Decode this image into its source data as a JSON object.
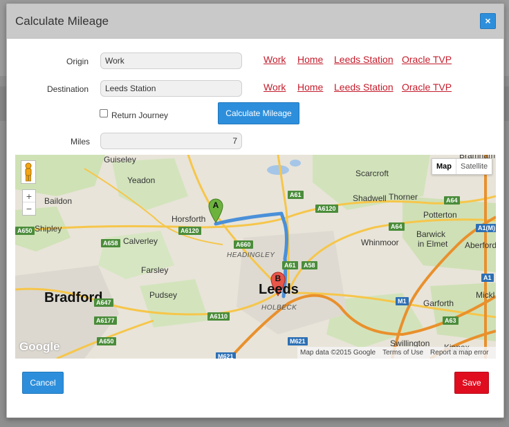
{
  "modal": {
    "title": "Calculate Mileage",
    "close_label": "×"
  },
  "form": {
    "origin_label": "Origin",
    "origin_value": "Work",
    "destination_label": "Destination",
    "destination_value": "Leeds Station",
    "presets": [
      "Work",
      "Home",
      "Leeds Station",
      "Oracle TVP"
    ],
    "return_journey_label": "Return Journey",
    "return_journey_checked": false,
    "calculate_label": "Calculate Mileage",
    "miles_label": "Miles",
    "miles_value": "7"
  },
  "map": {
    "type_options": [
      "Map",
      "Satellite"
    ],
    "selected_type": "Map",
    "zoom_in": "+",
    "zoom_out": "−",
    "marker_a": "A",
    "marker_b": "B",
    "route_color": "#4a90d9",
    "marker_a_color": "#6cb33e",
    "marker_b_color": "#e8564a",
    "places": {
      "guiseley": "Guiseley",
      "yeadon": "Yeadon",
      "baildon": "Baildon",
      "horsforth": "Horsforth",
      "shipley": "Shipley",
      "calverley": "Calverley",
      "farsley": "Farsley",
      "pudsey": "Pudsey",
      "bradford": "Bradford",
      "headingley": "HEADINGLEY",
      "leeds": "Leeds",
      "holbeck": "HOLBECK",
      "scarcroft": "Scarcroft",
      "shadwell": "Shadwell",
      "thorner": "Thorner",
      "bramham": "Bramham",
      "potterton": "Potterton",
      "whinmoor": "Whinmoor",
      "barwick": "Barwick",
      "in_elmet": "in Elmet",
      "aberford": "Aberford",
      "garforth": "Garforth",
      "mickle": "Mickl",
      "swillington": "Swillington",
      "kippax": "Kippax"
    },
    "roads": {
      "a650_left": "A650",
      "a6120_left": "A6120",
      "a658": "A658",
      "a660": "A660",
      "a61_top": "A61",
      "a6120_right": "A6120",
      "a61_mid": "A61",
      "a58": "A58",
      "a64_right": "A64",
      "a64_mid": "A64",
      "a1m": "A1(M)",
      "a647": "A647",
      "a6177": "A6177",
      "a6110": "A6110",
      "a650_bottom": "A650",
      "m1": "M1",
      "a63": "A63",
      "m621_a": "M621",
      "m621_b": "M621",
      "a1_right": "A1"
    },
    "google_logo": "Google",
    "attribution": [
      "Map data ©2015 Google",
      "Terms of Use",
      "Report a map error"
    ]
  },
  "footer": {
    "cancel_label": "Cancel",
    "save_label": "Save"
  }
}
